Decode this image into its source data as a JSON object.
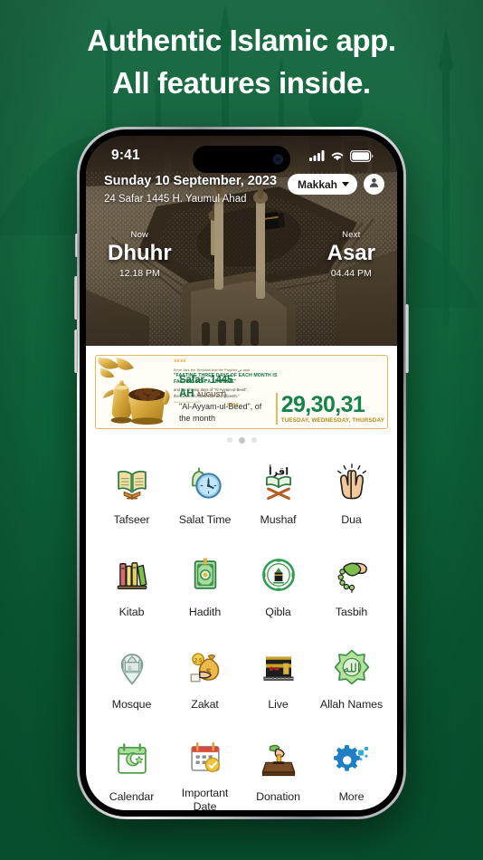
{
  "promo": {
    "headline_line1": "Authentic Islamic app.",
    "headline_line2": "All features inside.",
    "background_color": "#0a6239"
  },
  "statusbar": {
    "time": "9:41",
    "signal_icon": "cellular-signal-icon",
    "wifi_icon": "wifi-icon",
    "battery_icon": "battery-icon"
  },
  "header": {
    "gregorian_date": "Sunday 10 September, 2023",
    "hijri_date": "24 Safar 1445 H. Yaumul Ahad",
    "city": "Makkah",
    "city_caret_icon": "chevron-down-icon",
    "profile_icon": "user-avatar-icon"
  },
  "prayer": {
    "now": {
      "tag": "Now",
      "name": "Dhuhr",
      "time": "12.18 PM"
    },
    "next": {
      "tag": "Next",
      "name": "Asar",
      "time": "04.44 PM"
    }
  },
  "banner": {
    "quote_open_icon": "quote-open-icon",
    "quote_close_icon": "quote-close-icon",
    "quote_pre": "From Jarir ibn 'Abdullah that the Prophet ص said",
    "quote_main_l1": "\"FASTING THREE DAYS OF EACH MONTH IS",
    "quote_main_l2": "FASTING FOR A LIFETIME\"",
    "quote_sub_l1": "and the shining days of \"Al-Ayyam-ul-Beed\",",
    "quote_sub_l2": "the thirteenth, fourteenth and fifteenth.\"",
    "quote_ref": "Sunan an-Nasa'i 2420",
    "month": "Safar- 1445 AH",
    "month_en": "AUGUST)",
    "event_name": "\"Al-Ayyam-ul-Beed\", of the month",
    "days_numbers": "29,30,31",
    "days_names": "TUESDAY, WEDNESDAY, THURSDAY",
    "accent_gold": "#e0b762",
    "accent_green": "#12834a"
  },
  "carousel": {
    "dots": [
      {
        "active": false
      },
      {
        "active": true
      },
      {
        "active": false
      }
    ]
  },
  "grid": {
    "items": [
      {
        "label": "Tafseer",
        "icon": "open-quran-book-icon"
      },
      {
        "label": "Salat Time",
        "icon": "clock-mosque-icon"
      },
      {
        "label": "Mushaf",
        "icon": "quran-stand-iqra-icon"
      },
      {
        "label": "Dua",
        "icon": "praying-hands-icon"
      },
      {
        "label": "Kitab",
        "icon": "bookshelf-icon"
      },
      {
        "label": "Hadith",
        "icon": "green-book-icon"
      },
      {
        "label": "Qibla",
        "icon": "qibla-compass-icon"
      },
      {
        "label": "Tasbih",
        "icon": "prayer-beads-hand-icon"
      },
      {
        "label": "Mosque",
        "icon": "mosque-pin-icon"
      },
      {
        "label": "Zakat",
        "icon": "money-bag-hand-icon"
      },
      {
        "label": "Live",
        "icon": "kaaba-icon"
      },
      {
        "label": "Allah Names",
        "icon": "allah-calligraphy-icon"
      },
      {
        "label": "Calendar",
        "icon": "hijri-calendar-icon"
      },
      {
        "label": "Important\nDate",
        "icon": "calendar-check-icon"
      },
      {
        "label": "Donation",
        "icon": "donation-box-icon"
      },
      {
        "label": "More",
        "icon": "gear-more-icon"
      }
    ]
  }
}
